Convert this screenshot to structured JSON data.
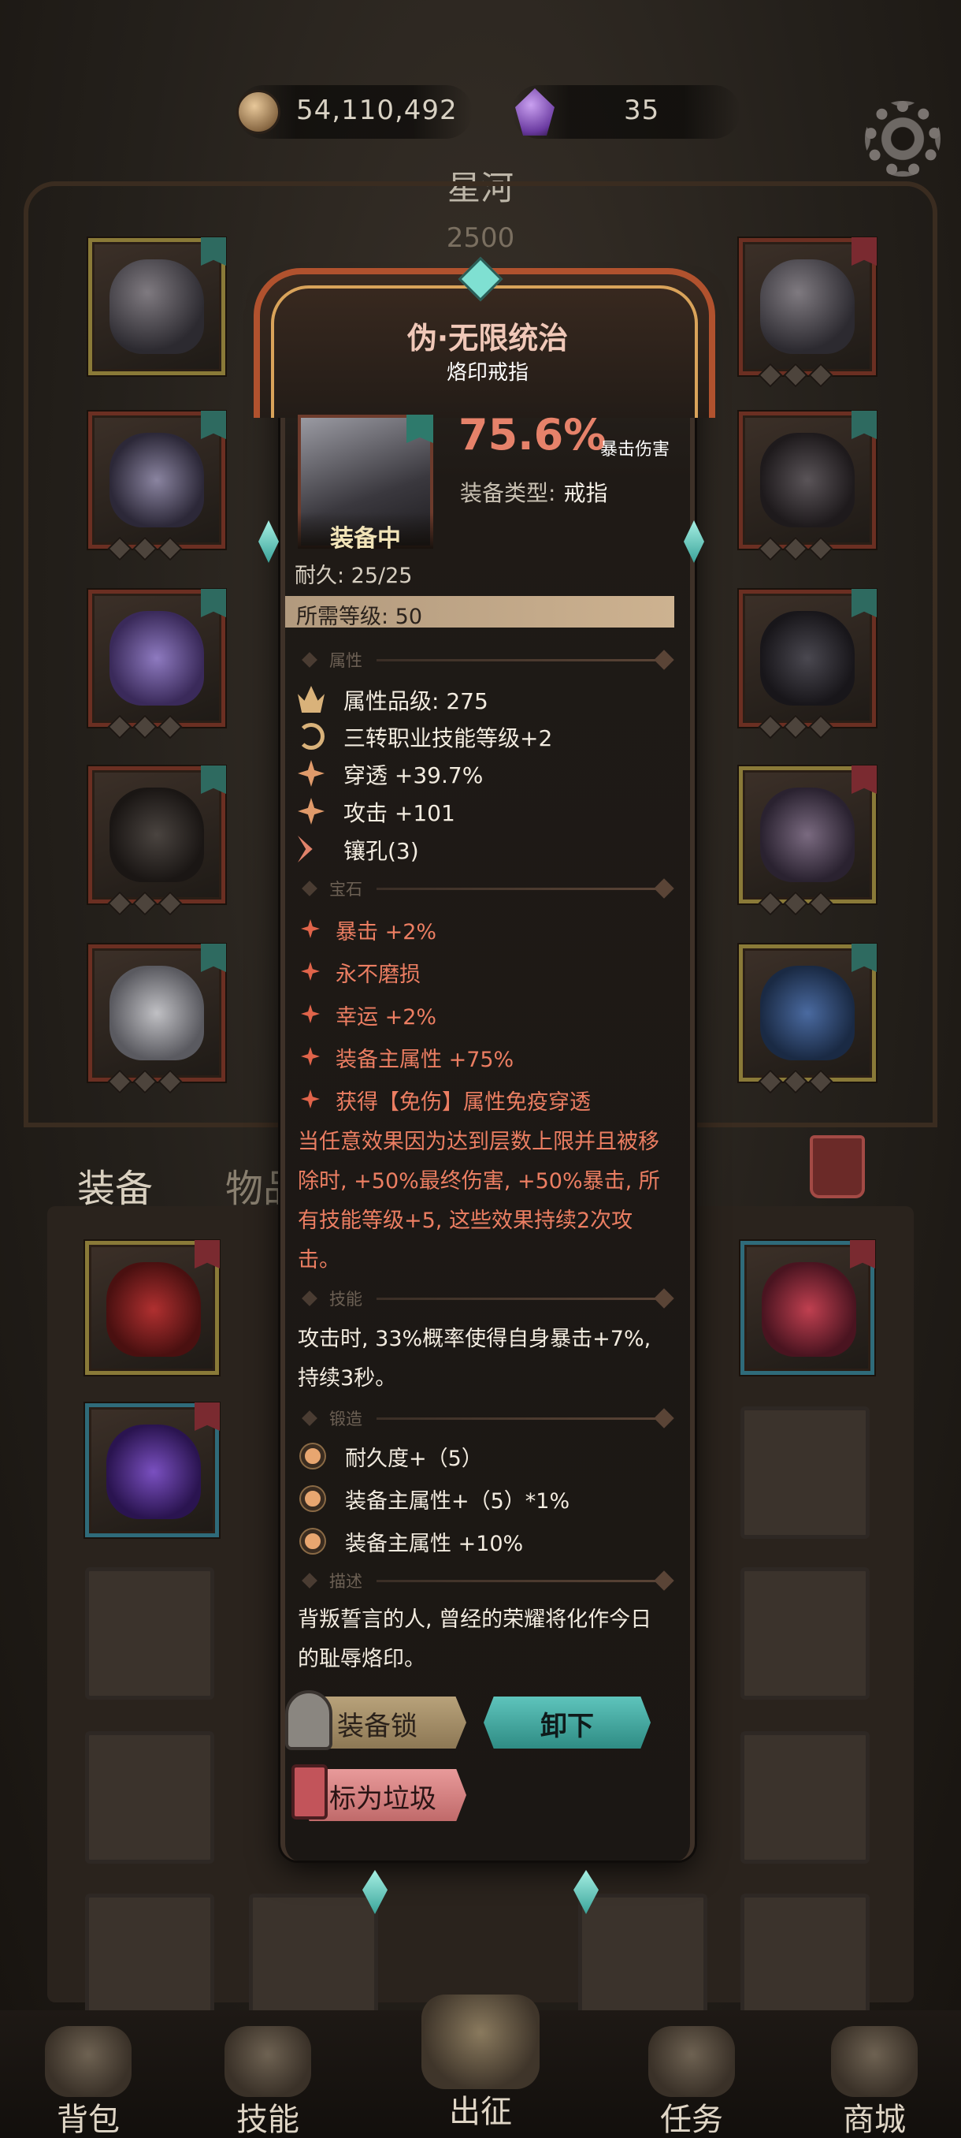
{
  "top": {
    "gold": "54,110,492",
    "gems": "35",
    "hero_name": "星河",
    "hero_level": "2500"
  },
  "tabs": {
    "equipment": "装备",
    "items": "物品"
  },
  "popup": {
    "title": "伪·无限统治",
    "subtitle": "烙印戒指",
    "equipped_label": "装备中",
    "main_stat_value": "75.6%",
    "main_stat_name": "暴击伤害",
    "type_label": "装备类型:",
    "type_value": "戒指",
    "durability": "耐久: 25/25",
    "required_level": "所需等级: 50",
    "sections": {
      "attributes": "属性",
      "gems": "宝石",
      "skills": "技能",
      "forging": "锻造",
      "description": "描述"
    },
    "attributes": [
      {
        "icon": "crown-icon",
        "text": "属性品级: 275"
      },
      {
        "icon": "cycle-icon",
        "text": "三转职业技能等级+2"
      },
      {
        "icon": "pierce-icon",
        "text": "穿透 +39.7%"
      },
      {
        "icon": "attack-icon",
        "text": "攻击 +101"
      },
      {
        "icon": "socket-icon",
        "text": "镶孔(3)"
      }
    ],
    "gems": [
      "暴击 +2%",
      "永不磨损",
      "幸运 +2%",
      "装备主属性 +75%",
      "获得【免伤】属性免疫穿透"
    ],
    "gem_effect": "当任意效果因为达到层数上限并且被移除时, +50%最终伤害, +50%暴击, 所有技能等级+5, 这些效果持续2次攻击。",
    "skill_text": "攻击时, 33%概率使得自身暴击+7%, 持续3秒。",
    "forging": [
      "耐久度+（5）",
      "装备主属性+（5）*1%",
      "装备主属性 +10%"
    ],
    "description": "背叛誓言的人, 曾经的荣耀将化作今日的耻辱烙印。",
    "buttons": {
      "lock": "装备锁",
      "unequip": "卸下",
      "mark_trash": "标为垃圾"
    }
  },
  "nav": {
    "bag": "背包",
    "skills": "技能",
    "battle": "出征",
    "quests": "任务",
    "shop": "商城"
  },
  "colors": {
    "accent_red": "#e6826a",
    "accent_teal": "#5ec4bc",
    "gem_text": "#ec7e62"
  }
}
